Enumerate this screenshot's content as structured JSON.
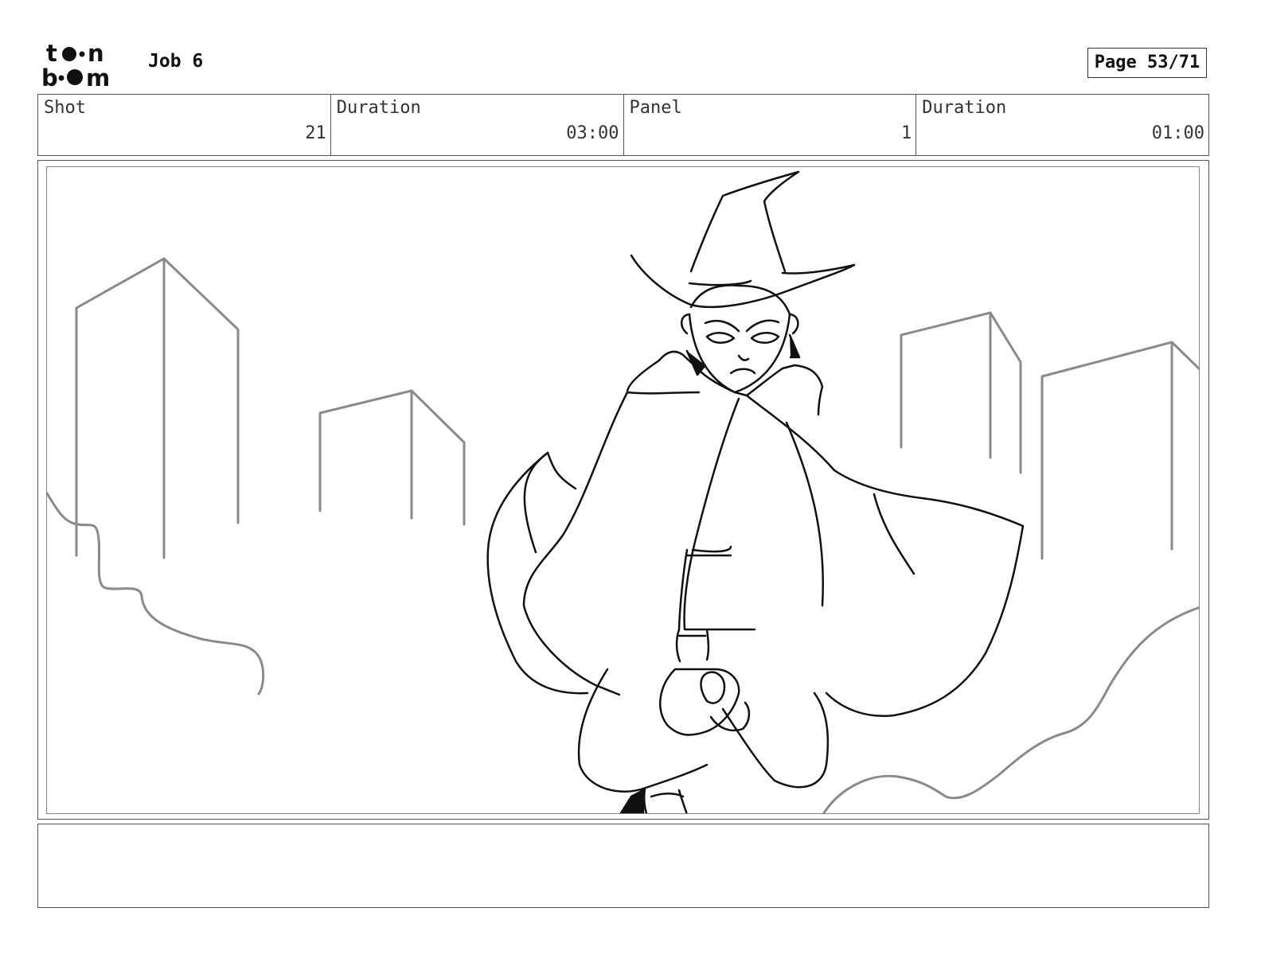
{
  "header": {
    "logo_text": "toon boom",
    "job_title": "Job 6",
    "page_label": "Page 53/71"
  },
  "info": [
    {
      "label": "Shot",
      "value": "21"
    },
    {
      "label": "Duration",
      "value": "03:00"
    },
    {
      "label": "Panel",
      "value": "1"
    },
    {
      "label": "Duration",
      "value": "01:00"
    }
  ],
  "panel": {
    "image": "storyboard-sketch-witch-with-cape-and-city-buildings"
  },
  "notes": {
    "text": ""
  },
  "colors": {
    "line": "#111111",
    "background_sketch": "#8a8a8a",
    "border": "#555555"
  }
}
